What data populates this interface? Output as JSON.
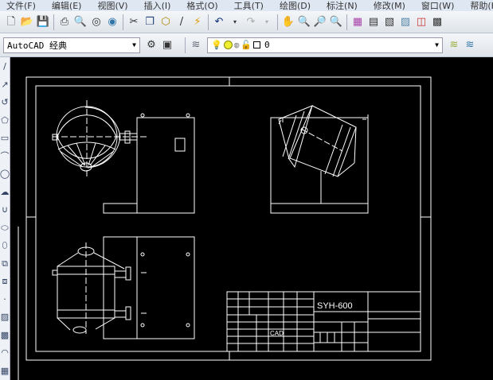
{
  "menu": [
    "文件(F)",
    "编辑(E)",
    "视图(V)",
    "插入(I)",
    "格式(O)",
    "工具(T)",
    "绘图(D)",
    "标注(N)",
    "修改(M)",
    "窗口(W)",
    "帮助(H)"
  ],
  "toolbar1": {
    "icons": [
      "new-icon",
      "open-icon",
      "save-icon",
      "print-icon",
      "preview-icon",
      "publish-icon",
      "globe-icon",
      "cut-icon",
      "copy-icon",
      "paste-icon",
      "brush-icon",
      "matchprop-icon",
      "undo-icon",
      "dropdown-icon",
      "redo-icon",
      "dropdown-icon",
      "pan-icon",
      "zoom-realtime-icon",
      "zoom-window-icon",
      "zoom-previous-icon",
      "properties-icon",
      "design-center-icon",
      "tool-palette-icon",
      "sheet-set-icon",
      "markup-icon",
      "calculator-icon"
    ]
  },
  "workspace": {
    "value": "AutoCAD 经典"
  },
  "layer": {
    "value": "0"
  },
  "left_toolbar": [
    "line-icon",
    "construction-line-icon",
    "polyline-icon",
    "polygon-icon",
    "rectangle-icon",
    "arc-icon",
    "circle-icon",
    "revcloud-icon",
    "spline-icon",
    "ellipse-icon",
    "ellipse-arc-icon",
    "insert-block-icon",
    "make-block-icon",
    "point-icon",
    "hatch-icon",
    "gradient-icon",
    "region-icon",
    "table-icon"
  ],
  "title_block": {
    "drawing_title": "SYH-600",
    "software": "CAD"
  },
  "colors": {
    "canvas": "#000000",
    "lines": "#ffffff",
    "menubar": "#dfe7f2"
  }
}
